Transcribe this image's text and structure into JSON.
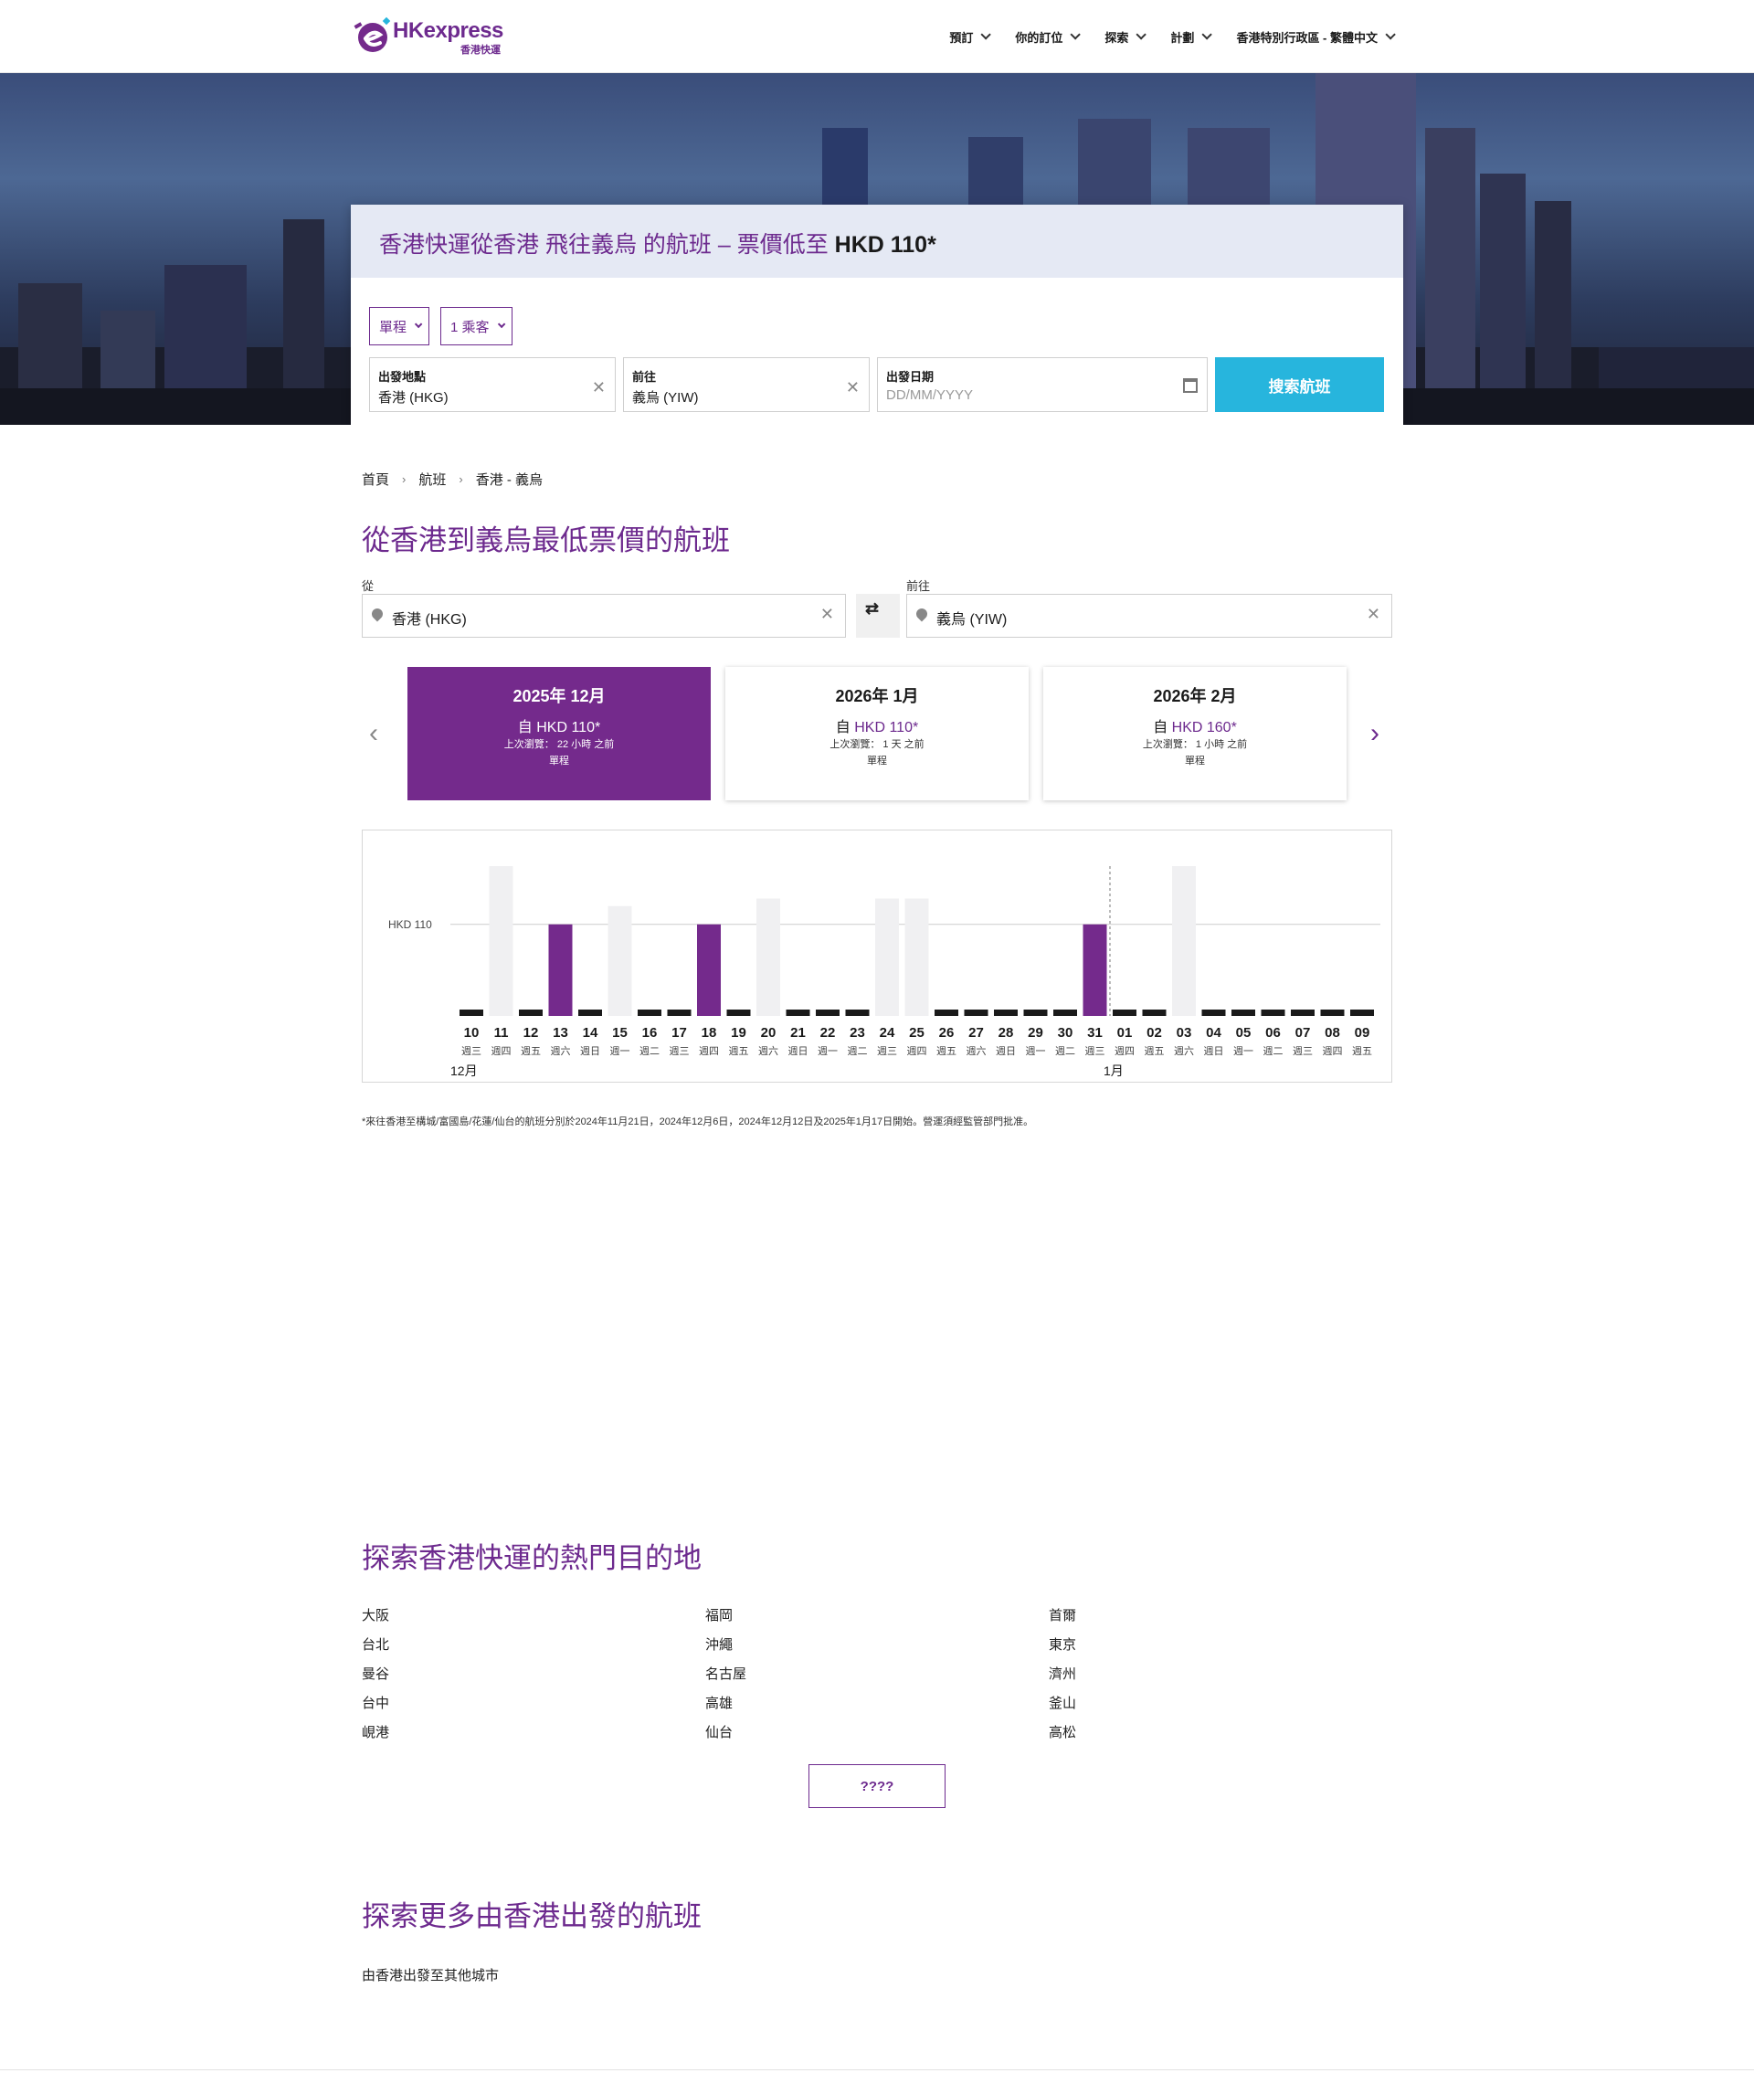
{
  "header": {
    "logo_text": "HKexpress",
    "logo_sub": "香港快運",
    "nav": [
      {
        "label": "預訂"
      },
      {
        "label": "你的訂位"
      },
      {
        "label": "探索"
      },
      {
        "label": "計劃"
      },
      {
        "label": "香港特別行政區 - 繁體中文"
      }
    ]
  },
  "hero": {
    "title_prefix": "香港快運從香港 飛往義烏 的航班 – 票價低至 ",
    "title_price": "HKD 110*",
    "trip_type": "單程",
    "passengers": "1 乘客",
    "origin_label": "出發地點",
    "origin_value": "香港 (HKG)",
    "destination_label": "前往",
    "destination_value": "義烏 (YIW)",
    "date_label": "出發日期",
    "date_placeholder": "DD/MM/YYYY",
    "search_button": "搜索航班"
  },
  "breadcrumb": [
    "首頁",
    "航班",
    "香港 - 義烏"
  ],
  "lowest_fare_title": "從香港到義烏最低票價的航班",
  "route": {
    "from_label": "從",
    "from_value": "香港 (HKG)",
    "to_label": "前往",
    "to_value": "義烏 (YIW)"
  },
  "months": [
    {
      "title": "2025年 12月",
      "price_prefix": "自 ",
      "price": "HKD 110",
      "price_suffix": "*",
      "last_viewed": "上次瀏覽： 22 小時 之前",
      "trip": "單程"
    },
    {
      "title": "2026年 1月",
      "price_prefix": "自 ",
      "price": "HKD 110",
      "price_suffix": "*",
      "last_viewed": "上次瀏覽： 1 天 之前",
      "trip": "單程"
    },
    {
      "title": "2026年 2月",
      "price_prefix": "自 ",
      "price": "HKD 160",
      "price_suffix": "*",
      "last_viewed": "上次瀏覽： 1 小時 之前",
      "trip": "單程"
    }
  ],
  "colors": {
    "brand_purple": "#742a8c",
    "accent_blue": "#27b5dd",
    "no_fare_bar": "#1a1a1a",
    "unavailable_bar": "#f0f0f2"
  },
  "chart_data": {
    "type": "bar",
    "reference_label": "HKD 110",
    "reference_value": 110,
    "ylim": [
      0,
      180
    ],
    "month_labels": [
      {
        "label": "12月",
        "start_index": 0
      },
      {
        "label": "1月",
        "start_index": 22
      }
    ],
    "days": [
      {
        "day": "10",
        "weekday": "週三",
        "status": "none",
        "value": 0
      },
      {
        "day": "11",
        "weekday": "週四",
        "status": "unavailable",
        "value": 180
      },
      {
        "day": "12",
        "weekday": "週五",
        "status": "none",
        "value": 0
      },
      {
        "day": "13",
        "weekday": "週六",
        "status": "fare",
        "value": 110
      },
      {
        "day": "14",
        "weekday": "週日",
        "status": "none",
        "value": 0
      },
      {
        "day": "15",
        "weekday": "週一",
        "status": "unavailable",
        "value": 132
      },
      {
        "day": "16",
        "weekday": "週二",
        "status": "none",
        "value": 0
      },
      {
        "day": "17",
        "weekday": "週三",
        "status": "none",
        "value": 0
      },
      {
        "day": "18",
        "weekday": "週四",
        "status": "fare",
        "value": 110
      },
      {
        "day": "19",
        "weekday": "週五",
        "status": "none",
        "value": 0
      },
      {
        "day": "20",
        "weekday": "週六",
        "status": "unavailable",
        "value": 141
      },
      {
        "day": "21",
        "weekday": "週日",
        "status": "none",
        "value": 0
      },
      {
        "day": "22",
        "weekday": "週一",
        "status": "none",
        "value": 0
      },
      {
        "day": "23",
        "weekday": "週二",
        "status": "none",
        "value": 0
      },
      {
        "day": "24",
        "weekday": "週三",
        "status": "unavailable",
        "value": 141
      },
      {
        "day": "25",
        "weekday": "週四",
        "status": "unavailable",
        "value": 141
      },
      {
        "day": "26",
        "weekday": "週五",
        "status": "none",
        "value": 0
      },
      {
        "day": "27",
        "weekday": "週六",
        "status": "none",
        "value": 0
      },
      {
        "day": "28",
        "weekday": "週日",
        "status": "none",
        "value": 0
      },
      {
        "day": "29",
        "weekday": "週一",
        "status": "none",
        "value": 0
      },
      {
        "day": "30",
        "weekday": "週二",
        "status": "none",
        "value": 0
      },
      {
        "day": "31",
        "weekday": "週三",
        "status": "fare",
        "value": 110
      },
      {
        "day": "01",
        "weekday": "週四",
        "status": "none",
        "value": 0
      },
      {
        "day": "02",
        "weekday": "週五",
        "status": "none",
        "value": 0
      },
      {
        "day": "03",
        "weekday": "週六",
        "status": "unavailable",
        "value": 180
      },
      {
        "day": "04",
        "weekday": "週日",
        "status": "none",
        "value": 0
      },
      {
        "day": "05",
        "weekday": "週一",
        "status": "none",
        "value": 0
      },
      {
        "day": "06",
        "weekday": "週二",
        "status": "none",
        "value": 0
      },
      {
        "day": "07",
        "weekday": "週三",
        "status": "none",
        "value": 0
      },
      {
        "day": "08",
        "weekday": "週四",
        "status": "none",
        "value": 0
      },
      {
        "day": "09",
        "weekday": "週五",
        "status": "none",
        "value": 0
      }
    ]
  },
  "footnote": "*來往香港至構城/富國島/花蓮/仙台的航班分別於2024年11月21日，2024年12月6日，2024年12月12日及2025年1月17日開始。營運須經監管部門批准。",
  "popular_title": "探索香港快運的熱門目的地",
  "destinations": [
    [
      "大阪",
      "台北",
      "曼谷",
      "台中",
      "峴港"
    ],
    [
      "福岡",
      "沖繩",
      "名古屋",
      "高雄",
      "仙台"
    ],
    [
      "首爾",
      "東京",
      "濟州",
      "釜山",
      "高松"
    ]
  ],
  "more_button": "????",
  "more_flights_title": "探索更多由香港出發的航班",
  "more_flights_text": "由香港出發至其他城市"
}
